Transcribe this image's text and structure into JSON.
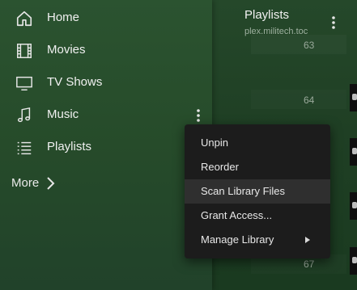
{
  "sidebar": {
    "items": [
      {
        "label": "Home",
        "icon": "home-icon"
      },
      {
        "label": "Movies",
        "icon": "film-icon"
      },
      {
        "label": "TV Shows",
        "icon": "tv-icon"
      },
      {
        "label": "Music",
        "icon": "music-note-icon"
      },
      {
        "label": "Playlists",
        "icon": "list-icon"
      }
    ],
    "more_label": "More"
  },
  "content": {
    "title": "Playlists",
    "subtitle": "plex.militech.toc",
    "row_numbers": [
      "63",
      "64",
      "67"
    ]
  },
  "context_menu": {
    "items": [
      {
        "label": "Unpin"
      },
      {
        "label": "Reorder"
      },
      {
        "label": "Scan Library Files"
      },
      {
        "label": "Grant Access..."
      },
      {
        "label": "Manage Library"
      }
    ],
    "highlighted": "Scan Library Files"
  },
  "colors": {
    "sidebar_bg": "#2b5330",
    "content_bg": "#1f3f24",
    "menu_bg": "#1c1c1c",
    "menu_highlight": "#2f2f2f",
    "text": "#f0f0f0"
  }
}
